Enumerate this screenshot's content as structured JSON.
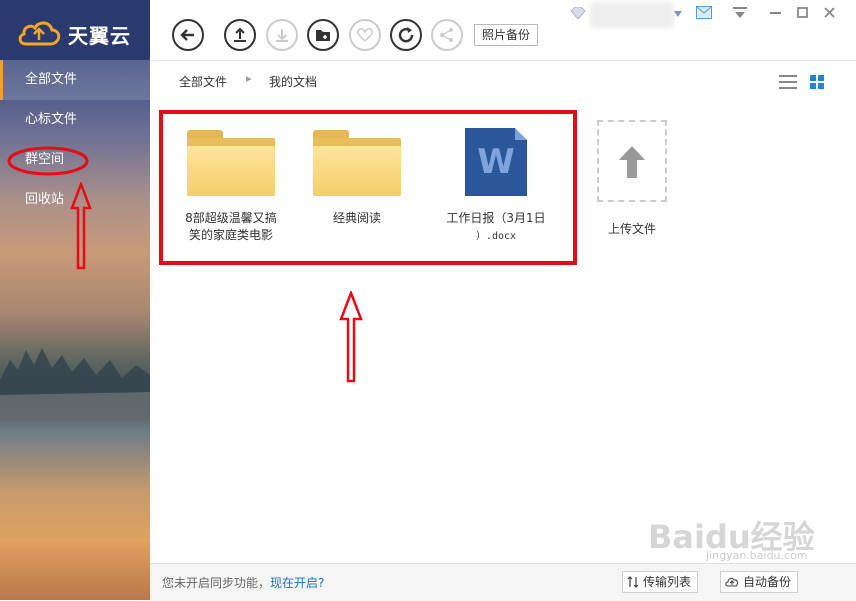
{
  "app": {
    "logo_text": "天翼云"
  },
  "sidebar": {
    "items": [
      {
        "label": "全部文件",
        "active": true
      },
      {
        "label": "心标文件"
      },
      {
        "label": "群空间"
      },
      {
        "label": "回收站"
      }
    ]
  },
  "toolbar": {
    "buttons": [
      "back-icon",
      "upload-icon",
      "download-icon",
      "new-folder-icon",
      "favorite-icon",
      "refresh-icon",
      "share-icon"
    ],
    "photo_backup_label": "照片备份"
  },
  "breadcrumb": {
    "root": "全部文件",
    "current": "我的文档"
  },
  "files": [
    {
      "name_line1": "8部超级温馨又搞",
      "name_line2": "笑的家庭类电影",
      "type": "folder"
    },
    {
      "name_line1": "经典阅读",
      "name_line2": "",
      "type": "folder"
    },
    {
      "name_line1": "工作日报（3月1日",
      "name_line2": "）.docx",
      "type": "docx",
      "icon_letter": "W"
    }
  ],
  "upload": {
    "label": "上传文件"
  },
  "footer": {
    "sync_msg": "您未开启同步功能，",
    "sync_link": "现在开启?",
    "transfer_label": "传输列表",
    "auto_backup_label": "自动备份"
  },
  "watermark": {
    "brand": "Bai",
    "brand2": "du",
    "suffix": "经验",
    "url": "jingyan.baidu.com"
  },
  "colors": {
    "sidebar_top": "#2b3a6e",
    "accent": "#f0a030",
    "annotation_red": "#e50c18",
    "link": "#1a73c8",
    "word_blue": "#2b579a"
  }
}
